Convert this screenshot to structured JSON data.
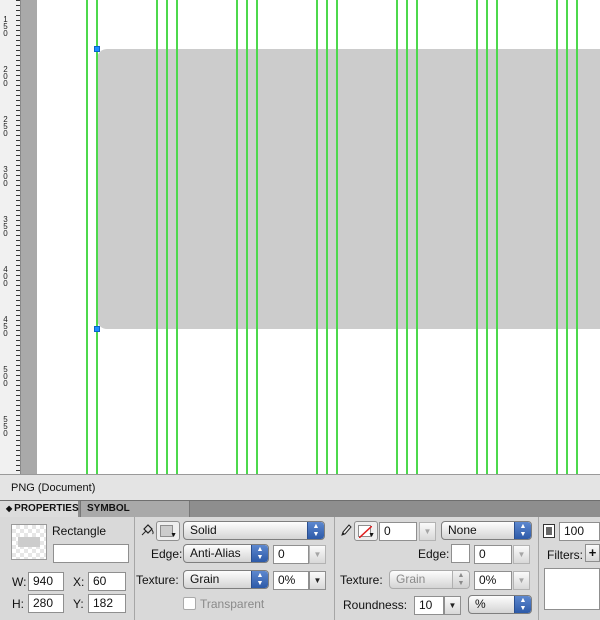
{
  "ruler": {
    "labels": [
      "150",
      "200",
      "250",
      "300",
      "350",
      "400",
      "450",
      "500",
      "550"
    ]
  },
  "status": {
    "document": "PNG (Document)"
  },
  "tabs": {
    "properties": "PROPERTIES",
    "symbol_properties": "SYMBOL PROPERTIES"
  },
  "object": {
    "type": "Rectangle",
    "name": "",
    "w_label": "W:",
    "w": "940",
    "h_label": "H:",
    "h": "280",
    "x_label": "X:",
    "x": "60",
    "y_label": "Y:",
    "y": "182"
  },
  "fill": {
    "type": "Solid",
    "edge_label": "Edge:",
    "edge": "Anti-Alias",
    "edge_amount": "0",
    "texture_label": "Texture:",
    "texture": "Grain",
    "texture_amount": "0%",
    "transparent_label": "Transparent",
    "color": "#cccccc"
  },
  "stroke": {
    "size": "0",
    "type": "None",
    "edge_label": "Edge:",
    "edge_amount": "0",
    "texture_label": "Texture:",
    "texture": "Grain",
    "texture_amount": "0%",
    "roundness_label": "Roundness:",
    "roundness": "10",
    "roundness_unit": "%"
  },
  "effects": {
    "opacity": "100",
    "filters_label": "Filters:"
  },
  "colors": {
    "guide": "#4cd94c",
    "selection_handle": "#1e8fff",
    "shape_fill": "#cccccc"
  }
}
